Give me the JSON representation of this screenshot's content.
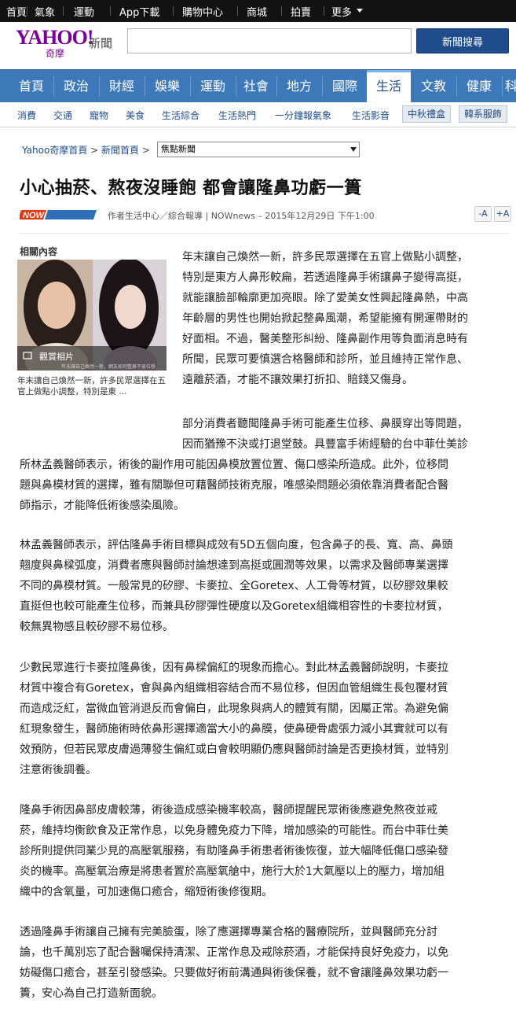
{
  "topbar": {
    "items": [
      "首頁",
      "氣象",
      "運動",
      "App下載",
      "購物中心",
      "商城",
      "拍賣",
      "更多"
    ]
  },
  "header": {
    "logo_text": "YAHOO!",
    "logo_sub": "奇摩",
    "section_label": "新聞",
    "search_button": "新聞搜尋",
    "search_value": ""
  },
  "mainnav": {
    "items": [
      "首頁",
      "政治",
      "財經",
      "娛樂",
      "運動",
      "社會",
      "地方",
      "國際",
      "生活",
      "文教",
      "健康",
      "科"
    ],
    "active": "生活"
  },
  "subnav": {
    "items": [
      "消費",
      "交通",
      "寵物",
      "美食",
      "生活綜合",
      "生活熱門",
      "一分鐘報氣象",
      "生活影音"
    ],
    "pills": [
      "中秋禮盒",
      "韓系服飾"
    ]
  },
  "breadcrumb": {
    "home": "Yahoo奇摩首頁",
    "sep1": ">",
    "news": "新聞首頁",
    "sep2": ">",
    "select_value": "焦點新聞"
  },
  "article": {
    "title": "小心抽菸、熬夜沒睡飽 都會讓隆鼻功虧一簣",
    "source_logo": "NOWnews",
    "byline": "作者生活中心／綜合報導 | NOWnews – 2015年12月29日 下午1:00",
    "font_smaller": "-A",
    "font_larger": "+A",
    "related_title": "相關內容",
    "gallery_label": "觀賞相片",
    "photo_overlay_text": "年末讓自己煥然一新，網友如何整鼻不易位移",
    "related_caption": "年末讓自己煥然一新，許多民眾選擇在五官上做點小調整，特別是東 ...",
    "paragraphs": [
      [
        "年末讓自己煥然一新，許多民眾選擇在五官上做點小調整，",
        "特別是東方人鼻形較扁，若透過隆鼻手術讓鼻子變得高挺，",
        "就能讓臉部輪廓更加亮眼。除了愛美女性興起隆鼻熱，中高",
        "年齡層的男性也開始掀起整鼻風潮，希望能擁有開運帶財的",
        "好面相。不過，醫美整形糾紛、隆鼻副作用等負面消息時有",
        "所聞，民眾可要慎選合格醫師和診所，並且維持正常作息、",
        "遠離菸酒，才能不讓效果打折扣、賠錢又傷身。"
      ],
      [
        "部分消費者聽聞隆鼻手術可能產生位移、鼻膜穿出等問題，",
        "因而猶豫不決或打退堂鼓。具豐富手術經驗的台中菲仕美診",
        "所林孟義醫師表示，術後的副作用可能因鼻模放置位置、傷口感染所造成。此外，位移問",
        "題與鼻模材質的選擇，雖有關聯但可藉醫師技術克服，唯感染問題必須依靠消費者配合醫",
        "師指示，才能降低術後感染風險。"
      ],
      [
        "林孟義醫師表示，評估隆鼻手術目標與成效有5D五個向度，包含鼻子的長、寬、高、鼻頭",
        "翹度與鼻樑弧度，消費者應與醫師討論想達到高挺或圓潤等效果，以需求及醫師專業選擇",
        "不同的鼻模材質。一般常見的矽膠、卡麥拉、全Goretex、人工骨等材質，以矽膠效果較",
        "直挺但也較可能產生位移，而兼具矽膠彈性硬度以及Goretex組織相容性的卡麥拉材質，",
        "較無異物感且較矽膠不易位移。"
      ],
      [
        "少數民眾進行卡麥拉隆鼻後，因有鼻樑偏紅的現象而擔心。對此林孟義醫師說明，卡麥拉",
        "材質中複合有Goretex，會與鼻內組織相容結合而不易位移，但因血管組織生長包覆材質",
        "而造成泛紅，當微血管消退反而會偏白，此現象與病人的體質有關，因屬正常。為避免偏",
        "紅現象發生，醫師施術時依鼻形選擇適當大小的鼻膜，使鼻硬骨處張力減小其實就可以有",
        "效預防，但若民眾皮膚過薄發生偏紅或白會較明顯仍應與醫師討論是否更換材質，並特別",
        "注意術後調養。"
      ],
      [
        "隆鼻手術因鼻部皮膚較薄，術後造成感染機率較高，醫師提醒民眾術後應避免熬夜並戒",
        "菸，維持均衡飲食及正常作息，以免身體免疫力下降，增加感染的可能性。而台中菲仕美",
        "診所則提供同業少見的高壓氧服務，有助隆鼻手術患者術後恢復，並大幅降低傷口感染發",
        "炎的機率。高壓氧治療是將患者置於高壓氧艙中，施行大於1大氣壓以上的壓力，增加組",
        "織中的含氧量，可加速傷口癒合，縮短術後修復期。"
      ],
      [
        "透過隆鼻手術讓自己擁有完美臉蛋，除了應選擇專業合格的醫療院所，並與醫師充分討",
        "論，也千萬別忘了配合醫囑保持清潔、正常作息及戒除菸酒，才能保持良好免疫力，以免",
        "妨礙傷口癒合，甚至引發感染。只要做好術前溝通與術後保養，就不會讓隆鼻效果功虧一",
        "簣，安心為自己打造新面貌。"
      ]
    ]
  },
  "colors": {
    "brand_purple": "#7b0099",
    "nav_blue": "#3d78b8",
    "link_blue": "#1f4c8c",
    "topbar_black": "#121212"
  }
}
